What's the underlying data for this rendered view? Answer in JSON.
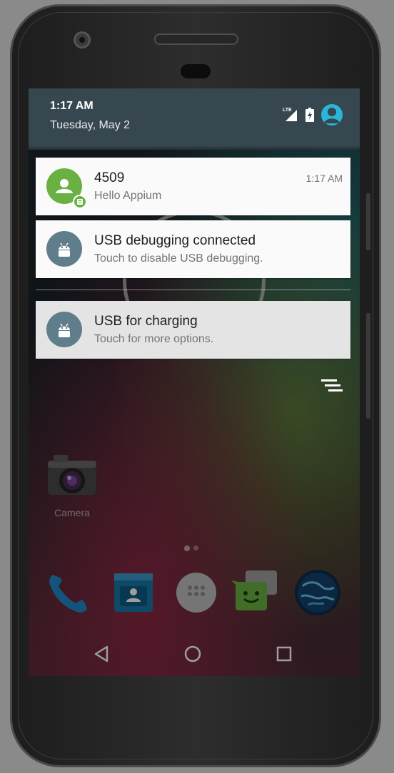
{
  "status_bar": {
    "time": "1:17 AM",
    "date": "Tuesday, May 2",
    "network_type": "LTE"
  },
  "notifications": [
    {
      "title": "4509",
      "text": "Hello Appium",
      "time": "1:17 AM",
      "icon": "person-icon"
    },
    {
      "title": "USB debugging connected",
      "text": "Touch to disable USB debugging.",
      "icon": "android-icon"
    },
    {
      "title": "USB for charging",
      "text": "Touch for more options.",
      "icon": "android-icon"
    }
  ],
  "home": {
    "camera_label": "Camera",
    "dock_icons": [
      "phone-icon",
      "contacts-icon",
      "app-drawer-icon",
      "messaging-icon",
      "browser-icon"
    ]
  },
  "colors": {
    "header": "#37474f",
    "accent_teal": "#29b6d8",
    "message_green": "#6ab042",
    "system_slate": "#607d8b"
  }
}
